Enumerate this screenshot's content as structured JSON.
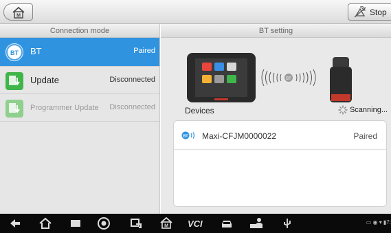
{
  "toolbar": {
    "stop_label": "Stop"
  },
  "left_panel": {
    "header": "Connection mode",
    "items": [
      {
        "name": "BT",
        "status": "Paired",
        "icon": "bt-icon"
      },
      {
        "name": "Update",
        "status": "Disconnected",
        "icon": "update-icon"
      },
      {
        "name": "Programmer Update",
        "status": "Disconnected",
        "icon": "programmer-update-icon"
      }
    ]
  },
  "right_panel": {
    "header": "BT setting",
    "devices_label": "Devices",
    "scanning_label": "Scanning...",
    "devices": [
      {
        "name": "Maxi-CFJM0000022",
        "status": "Paired"
      }
    ]
  },
  "navbar": {
    "icons": [
      "back-icon",
      "home-icon",
      "recent-apps-icon",
      "chrome-icon",
      "screenshot-icon",
      "maxisys-home-icon",
      "vci-icon",
      "car-icon",
      "technician-icon",
      "usb-icon"
    ]
  },
  "colors": {
    "accent": "#2f93e0",
    "update_green": "#3fb54a",
    "navbar": "#0a0a0a"
  }
}
